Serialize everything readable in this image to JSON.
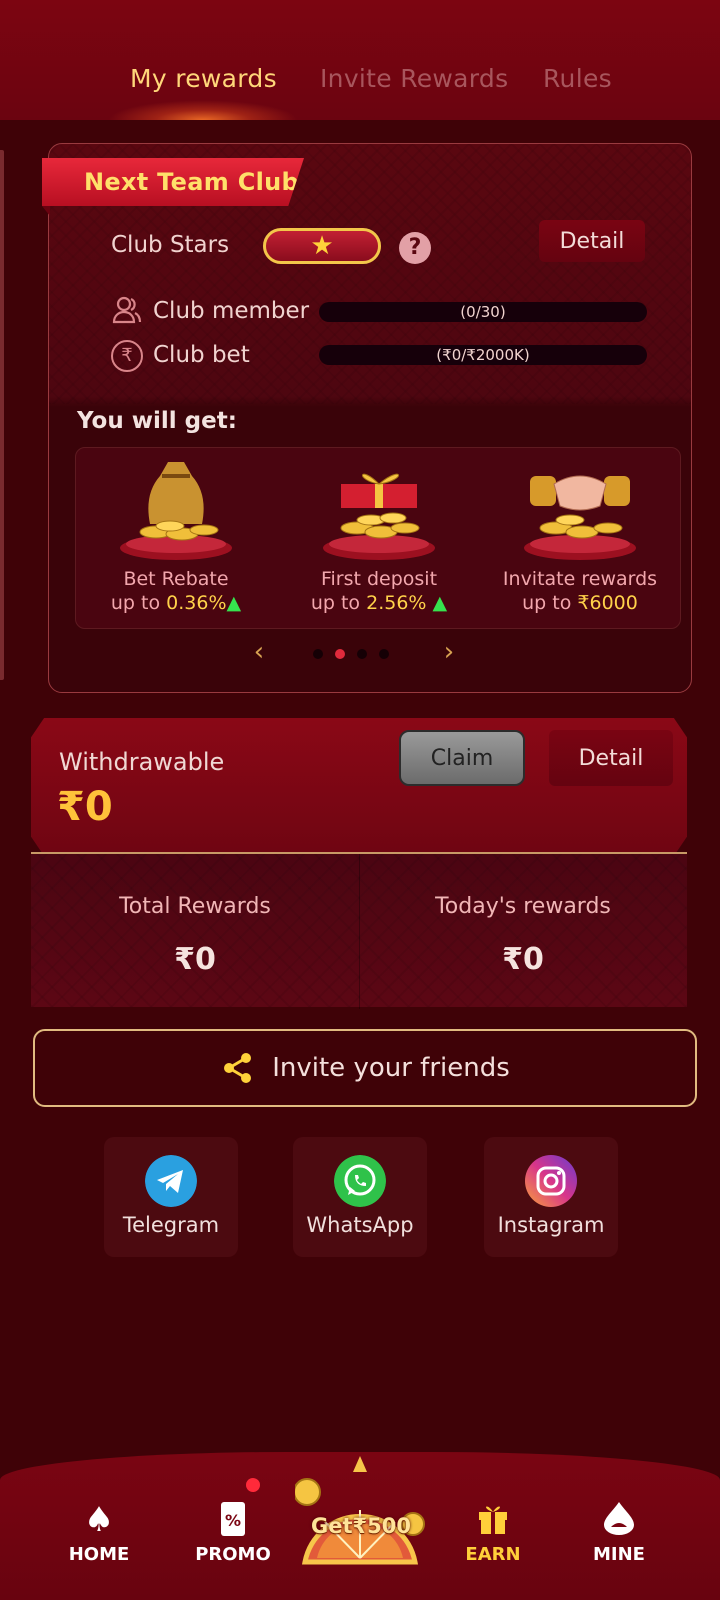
{
  "tabs": [
    {
      "label": "My rewards",
      "active": true
    },
    {
      "label": "Invite Rewards",
      "active": false
    },
    {
      "label": "Rules",
      "active": false
    }
  ],
  "club": {
    "ribbon_title": "Next Team Club",
    "stars_label": "Club Stars",
    "stars_icon": "star-icon",
    "help_symbol": "?",
    "detail_label": "Detail",
    "member_label": "Club member",
    "member_progress": "(0/30)",
    "member_progress_fraction": 0,
    "bet_label": "Club bet",
    "bet_progress": "(₹0/₹2000K)",
    "bet_progress_fraction": 0,
    "you_will_get": "You will get:",
    "benefits": [
      {
        "title": "Bet Rebate",
        "prefix": "up to ",
        "value": "0.36%",
        "arrow": "▲",
        "icon": "money-bag-coins-icon"
      },
      {
        "title": "First deposit",
        "prefix": "up to ",
        "value": "2.56%",
        "arrow": "▲",
        "icon": "gift-box-coins-icon"
      },
      {
        "title": "Invitate rewards",
        "prefix": "up to ",
        "value": "₹6000",
        "arrow": "",
        "icon": "handshake-coins-icon"
      }
    ],
    "carousel_pages": 4,
    "carousel_active_index": 1
  },
  "withdraw": {
    "label": "Withdrawable",
    "value": "₹0",
    "claim_label": "Claim",
    "detail_label": "Detail"
  },
  "rewards": {
    "total_label": "Total Rewards",
    "total_value": "₹0",
    "today_label": "Today's rewards",
    "today_value": "₹0"
  },
  "invite": {
    "label": "Invite your friends",
    "icon": "share-icon"
  },
  "share": [
    {
      "label": "Telegram",
      "icon": "telegram-icon",
      "color": "#2aa0e0"
    },
    {
      "label": "WhatsApp",
      "icon": "whatsapp-icon",
      "color": "#2fc24a"
    },
    {
      "label": "Instagram",
      "icon": "instagram-icon",
      "color": "#d8358a"
    }
  ],
  "bottom_nav": {
    "home": "HOME",
    "promo": "PROMO",
    "wheel": "Get₹500",
    "earn": "EARN",
    "mine": "MINE",
    "active": "earn"
  },
  "colors": {
    "background": "#3f0207",
    "accent_gold": "#ffcf3a",
    "brand_red": "#7a0512"
  }
}
